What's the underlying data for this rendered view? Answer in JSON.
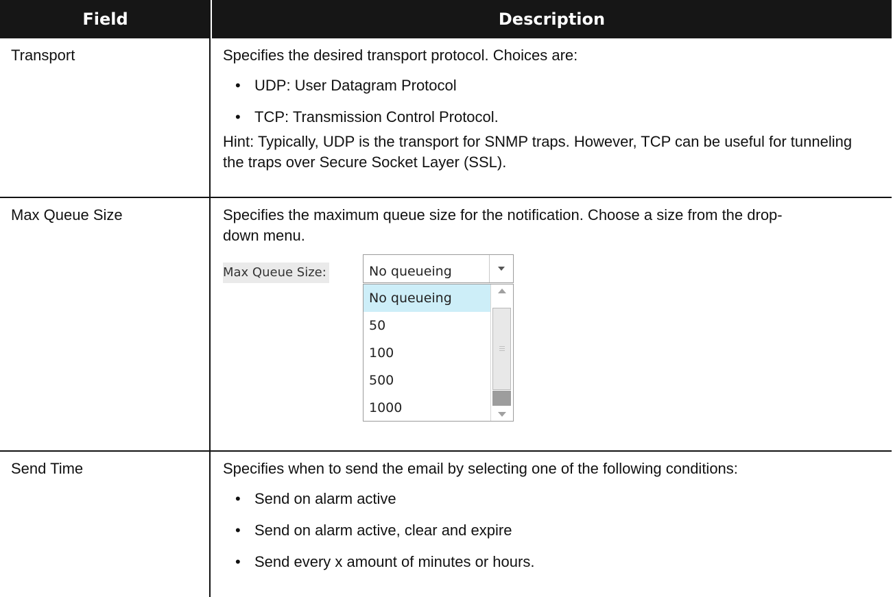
{
  "header": {
    "field_label": "Field",
    "description_label": "Description"
  },
  "rows": [
    {
      "field": "Transport",
      "intro": "Specifies the desired transport protocol. Choices are:",
      "bullets": [
        "UDP: User Datagram Protocol",
        "TCP: Transmission Control Protocol."
      ],
      "hint": "Hint: Typically, UDP is the transport for SNMP traps. However, TCP can be useful for tunneling the traps over Secure Socket Layer (SSL)."
    },
    {
      "field": "Max Queue Size",
      "intro": "Specifies the maximum queue size for the notification. Choose a size from the drop-down menu.",
      "widget": {
        "label": "Max Queue Size:",
        "selected": "No queueing",
        "options": [
          "No queueing",
          "50",
          "100",
          "500",
          "1000"
        ],
        "highlight_color": "#cdeef8"
      }
    },
    {
      "field": "Send Time",
      "intro": "Specifies when to send the email by selecting one of the following conditions:",
      "bullets": [
        "Send on alarm active",
        "Send on alarm active, clear and expire",
        "Send every x amount of minutes or hours."
      ]
    }
  ]
}
